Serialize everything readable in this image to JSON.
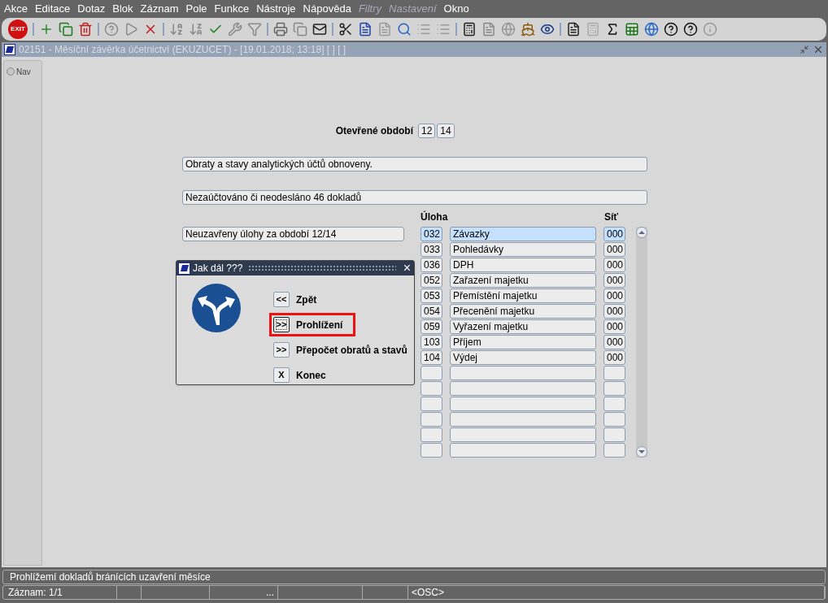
{
  "menu": [
    {
      "label": "Akce",
      "disabled": false
    },
    {
      "label": "Editace",
      "disabled": false
    },
    {
      "label": "Dotaz",
      "disabled": false
    },
    {
      "label": "Blok",
      "disabled": false
    },
    {
      "label": "Záznam",
      "disabled": false
    },
    {
      "label": "Pole",
      "disabled": false
    },
    {
      "label": "Funkce",
      "disabled": false
    },
    {
      "label": "Nástroje",
      "disabled": false
    },
    {
      "label": "Nápověda",
      "disabled": false
    },
    {
      "label": "Filtry",
      "disabled": true
    },
    {
      "label": "Nastavení",
      "disabled": true
    },
    {
      "label": "Okno",
      "disabled": false
    }
  ],
  "toolbar": {
    "exit_label": "EXIT"
  },
  "window": {
    "title": "02151 - Měsíční závěrka účetnictví (EKUZUCET) - [19.01.2018; 13:18]  [ ]  [ ]"
  },
  "nav": {
    "label": "Nav",
    "selected": false
  },
  "form": {
    "period_label": "Otevřené období",
    "period": [
      "12",
      "14"
    ],
    "message_1": "Obraty a stavy analytických účtů obnoveny.",
    "message_2": "Nezaúčtováno či neodesláno 46 dokladů",
    "message_3": "Neuzavřeny úlohy za období 12/14",
    "columns": [
      "Úloha",
      "Síť"
    ],
    "rows": [
      {
        "code": "032",
        "name": "Závazky",
        "net": "000",
        "selected": true
      },
      {
        "code": "033",
        "name": "Pohledávky",
        "net": "000",
        "selected": false
      },
      {
        "code": "036",
        "name": "DPH",
        "net": "000",
        "selected": false
      },
      {
        "code": "052",
        "name": "Zařazení majetku",
        "net": "000",
        "selected": false
      },
      {
        "code": "053",
        "name": "Přemístění majetku",
        "net": "000",
        "selected": false
      },
      {
        "code": "054",
        "name": "Přecenění majetku",
        "net": "000",
        "selected": false
      },
      {
        "code": "059",
        "name": "Vyřazení majetku",
        "net": "000",
        "selected": false
      },
      {
        "code": "103",
        "name": "Příjem",
        "net": "000",
        "selected": false
      },
      {
        "code": "104",
        "name": "Výdej",
        "net": "000",
        "selected": false
      }
    ]
  },
  "dialog": {
    "title": "Jak dál ???",
    "close": "×",
    "buttons": [
      {
        "key": "<<",
        "label": "Zpět",
        "focused": false,
        "highlighted": false
      },
      {
        "key": ">>",
        "label": "Prohlížení",
        "focused": true,
        "highlighted": true
      },
      {
        "key": ">>",
        "label": "Přepočet obratů a stavů",
        "focused": false,
        "highlighted": false
      },
      {
        "key": "X",
        "label": "Konec",
        "focused": false,
        "highlighted": false
      }
    ]
  },
  "status_bar": {
    "message": "Prohlížemí dokladů bránících uzavření měsíce",
    "record": "Záznam: 1/1",
    "cells": [
      "",
      "",
      "...",
      "",
      "",
      "<OSC>"
    ]
  }
}
